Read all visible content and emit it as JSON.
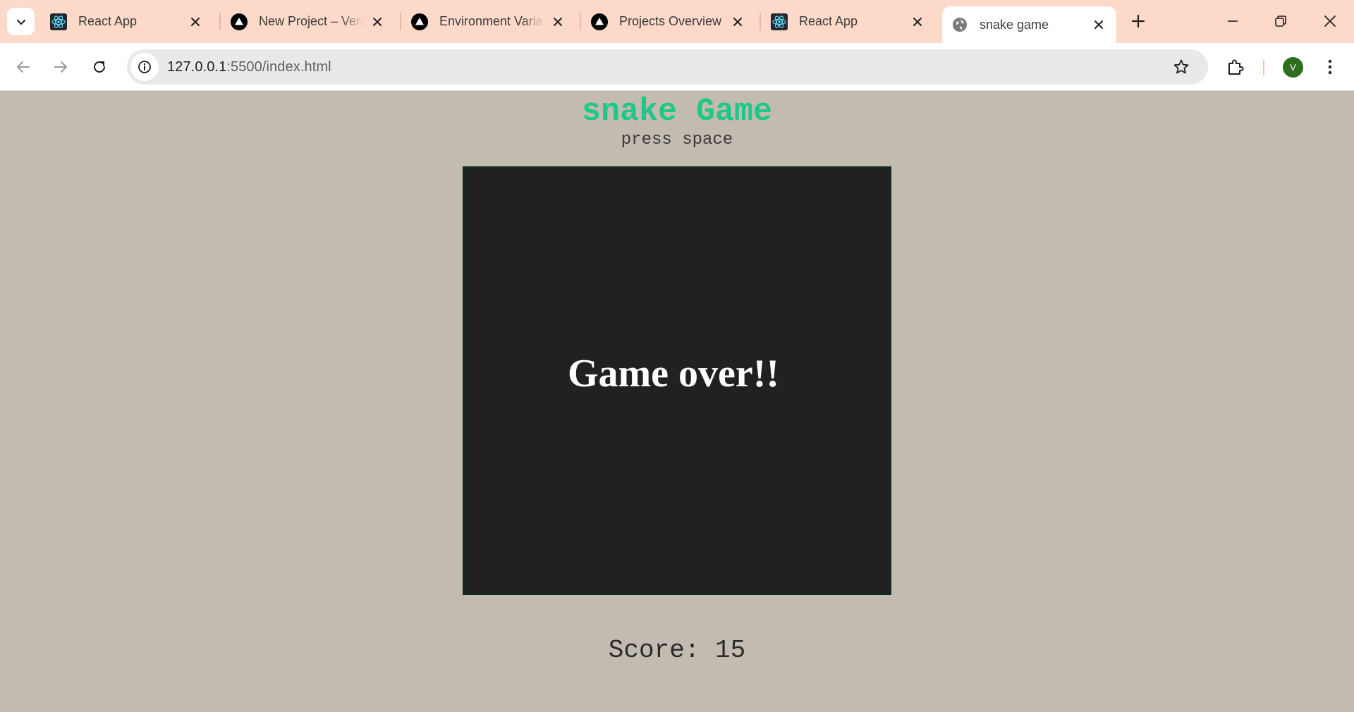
{
  "browser": {
    "tabs": [
      {
        "title": "React App",
        "icon": "react-icon"
      },
      {
        "title": "New Project – Vercel",
        "icon": "vercel-icon"
      },
      {
        "title": "Environment Variables",
        "icon": "vercel-icon"
      },
      {
        "title": "Projects Overview",
        "icon": "vercel-icon"
      },
      {
        "title": "React App",
        "icon": "react-icon"
      },
      {
        "title": "snake game",
        "icon": "globe-icon",
        "active": true
      }
    ],
    "url_host": "127.0.0.1",
    "url_rest": ":5500/index.html",
    "profile_initial": "V"
  },
  "page": {
    "title": "snake Game",
    "hint": "press space",
    "board_message": "Game over!!",
    "score_text": "Score: 15"
  },
  "colors": {
    "tabstrip": "#fdd9c9",
    "page_background": "#c4bbb0",
    "title_green": "#1fc887",
    "board": "#212121",
    "avatar": "#2c6e1d"
  }
}
